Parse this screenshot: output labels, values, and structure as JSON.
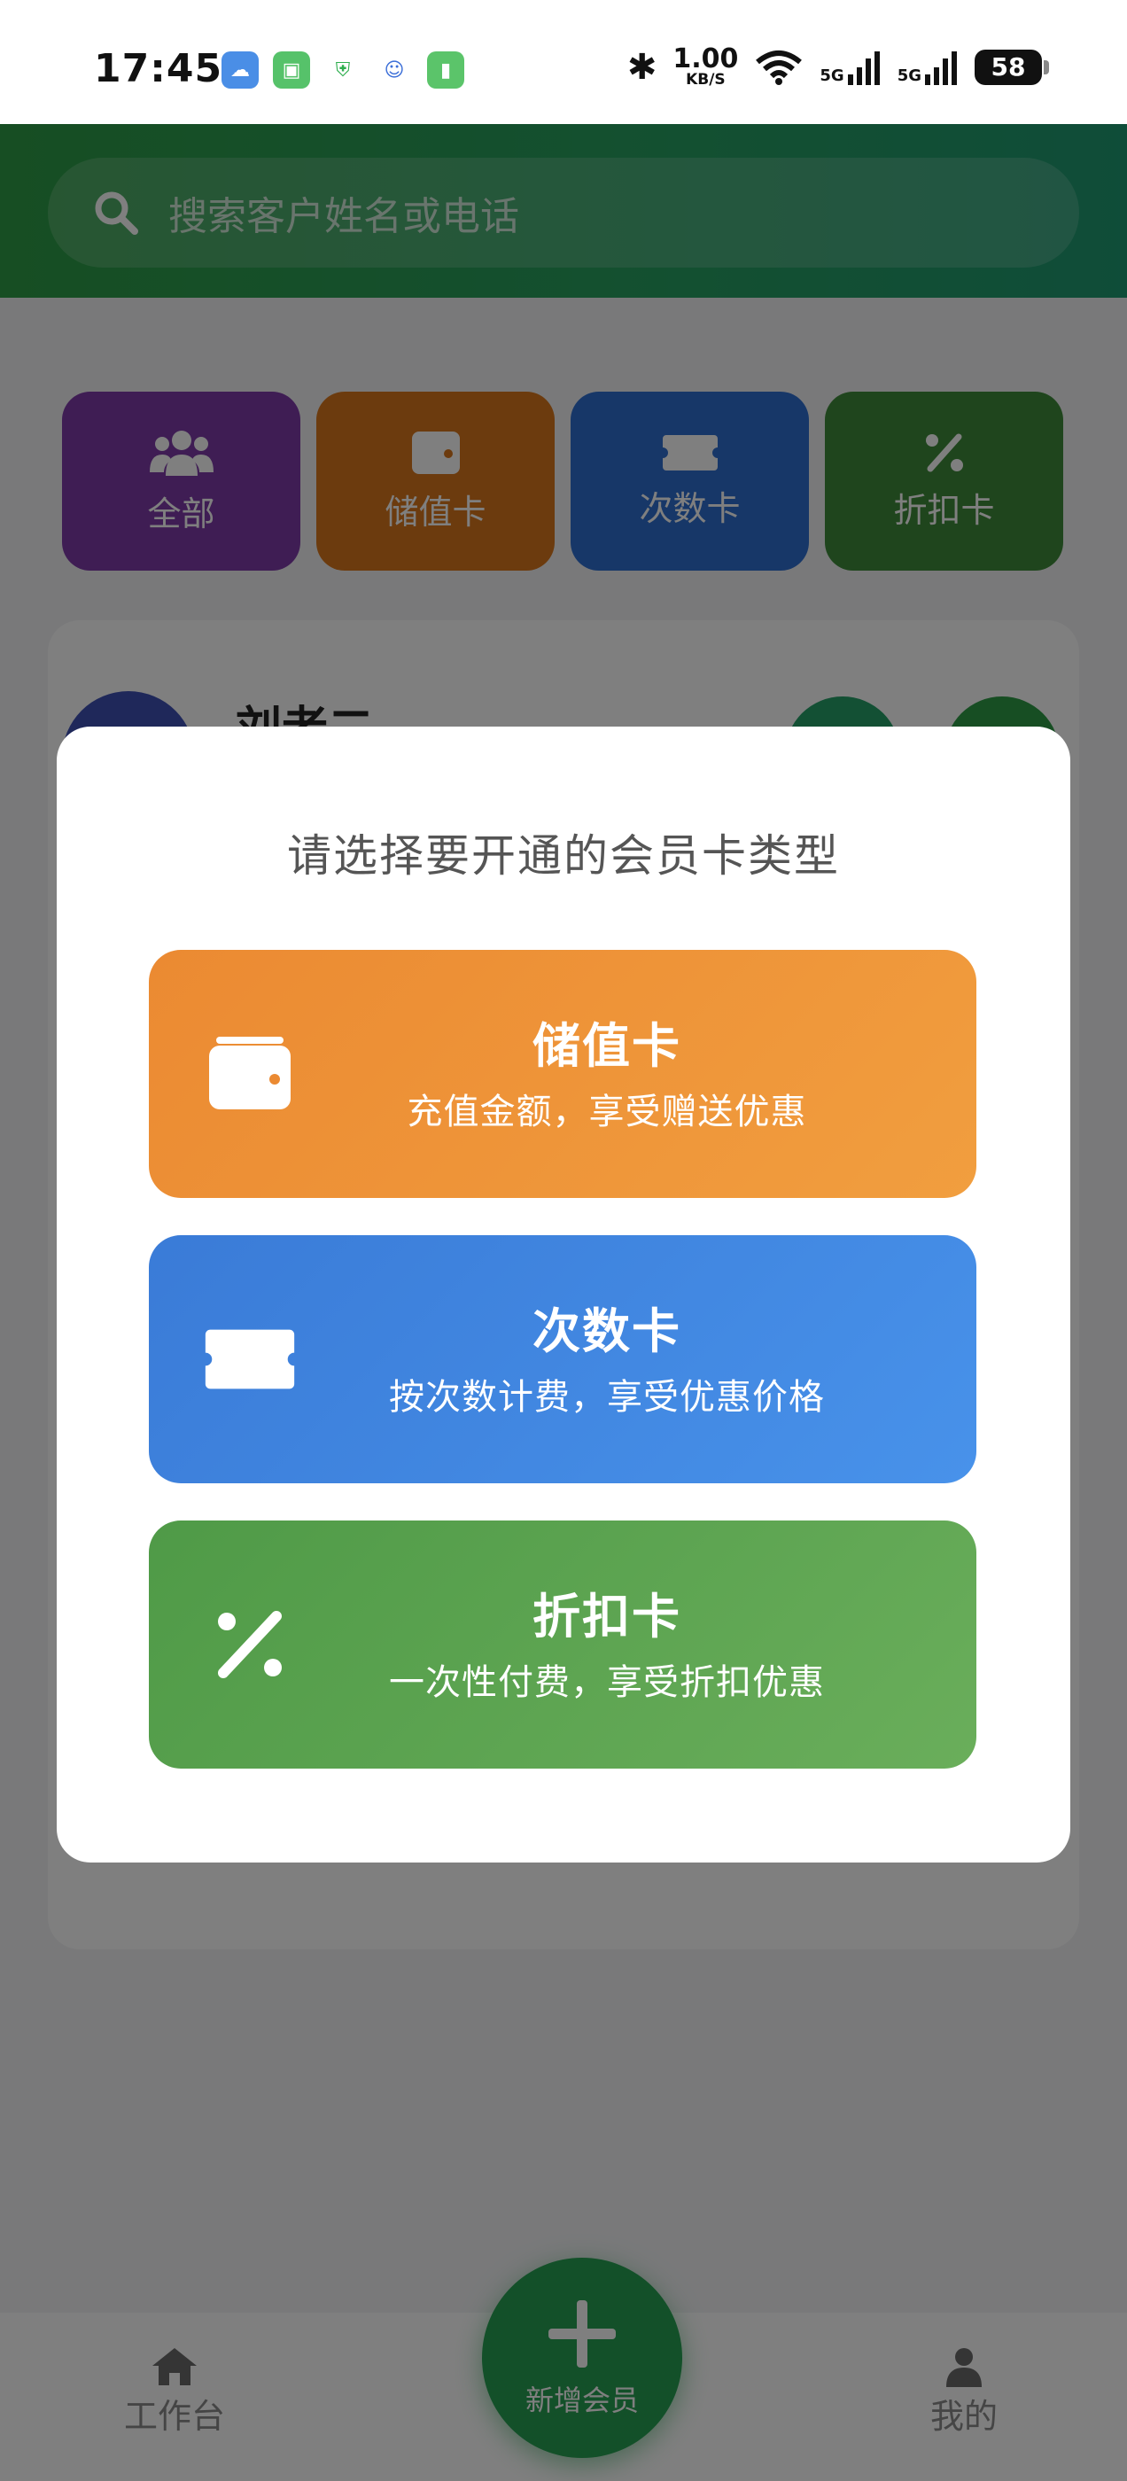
{
  "status_bar": {
    "time": "17:45",
    "speed_value": "1.00",
    "speed_unit": "KB/S",
    "net1": "5G",
    "net2": "5G",
    "battery": "58"
  },
  "search": {
    "placeholder": "搜索客户姓名或电话"
  },
  "categories": [
    {
      "label": "全部",
      "icon": "people-icon",
      "color": "#7e3aa8"
    },
    {
      "label": "储值卡",
      "icon": "wallet-icon",
      "color": "#d9771c"
    },
    {
      "label": "次数卡",
      "icon": "ticket-icon",
      "color": "#2f6fd0"
    },
    {
      "label": "折扣卡",
      "icon": "percent-icon",
      "color": "#3f8a3a"
    }
  ],
  "member": {
    "name": "刘老二"
  },
  "dialog": {
    "title": "请选择要开通的会员卡类型",
    "options": [
      {
        "title": "储值卡",
        "desc": "充值金额，享受赠送优惠",
        "icon": "wallet-icon"
      },
      {
        "title": "次数卡",
        "desc": "按次数计费，享受优惠价格",
        "icon": "ticket-icon"
      },
      {
        "title": "折扣卡",
        "desc": "一次性付费，享受折扣优惠",
        "icon": "percent-icon"
      }
    ]
  },
  "tabbar": {
    "workbench": "工作台",
    "add_member": "新增会员",
    "mine": "我的"
  },
  "colors": {
    "brand_green": "#27a052",
    "stored_orange": "#eb8a32",
    "times_blue": "#3a7bd7",
    "discount_green": "#4f9a47"
  }
}
